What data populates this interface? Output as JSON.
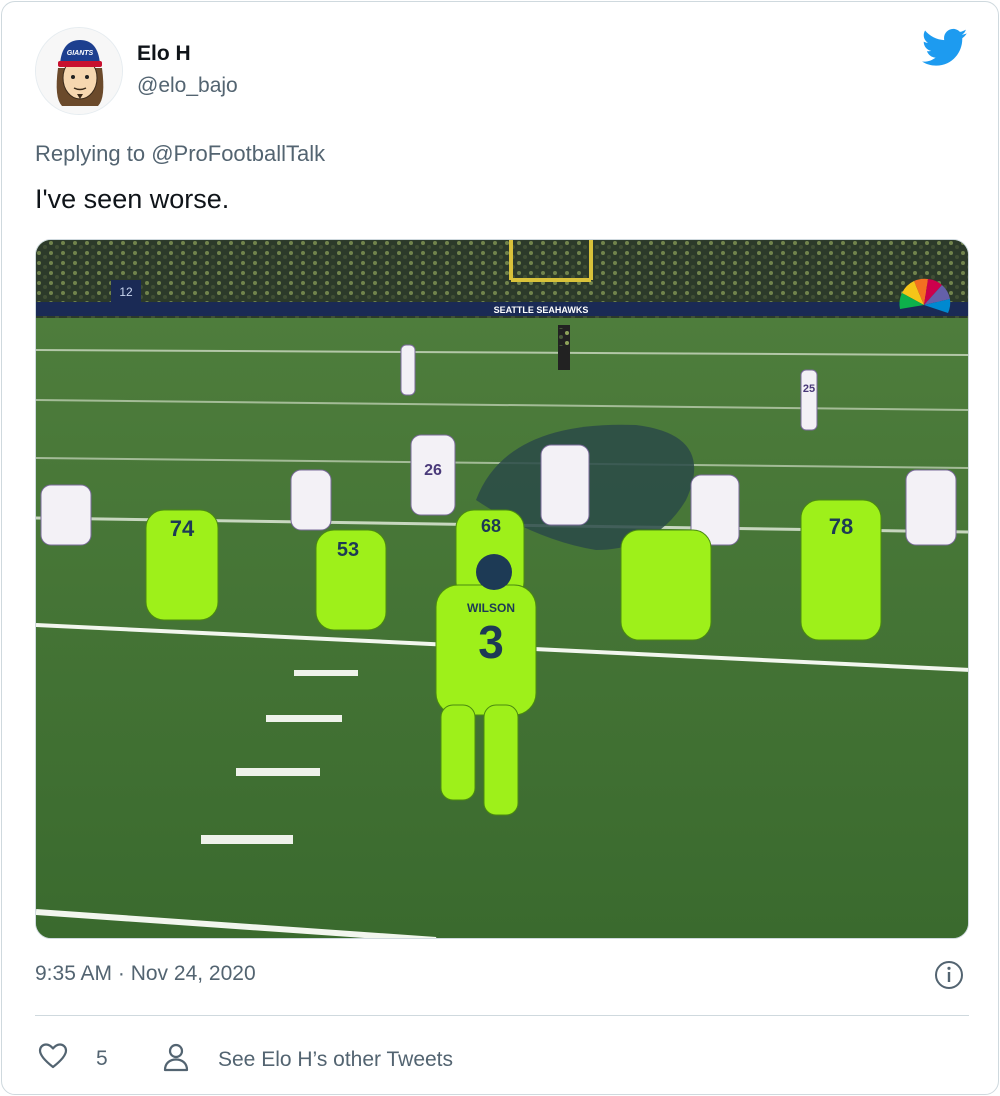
{
  "author": {
    "name": "Elo H",
    "handle": "@elo_bajo",
    "avatar_cap_text": "GIANTS"
  },
  "logo_icon": "twitter-bird-icon",
  "reply": {
    "prefix": "Replying to ",
    "mention": "@ProFootballTalk"
  },
  "tweet": {
    "text": "I've seen worse."
  },
  "media": {
    "description_icon": "football-photo",
    "quarterback_name": "WILSON",
    "quarterback_number": "3",
    "lineman_numbers": [
      "74",
      "53",
      "68",
      "78"
    ],
    "defense_numbers": [
      "26",
      "25"
    ],
    "stadium_sign": "SEATTLE SEAHAWKS",
    "jumbo_number": "12"
  },
  "meta": {
    "timestamp": "9:35 AM · Nov 24, 2020",
    "info_icon": "info-icon"
  },
  "actions": {
    "like_icon": "heart-icon",
    "like_count": "5",
    "profile_icon": "person-icon",
    "profile_label": "See Elo H’s other Tweets"
  },
  "colors": {
    "accent": "#1d9bf0",
    "secondary_text": "#536471",
    "border": "#cfd9de",
    "field_green": "#3f6e32",
    "action_green": "#9ef01a"
  }
}
